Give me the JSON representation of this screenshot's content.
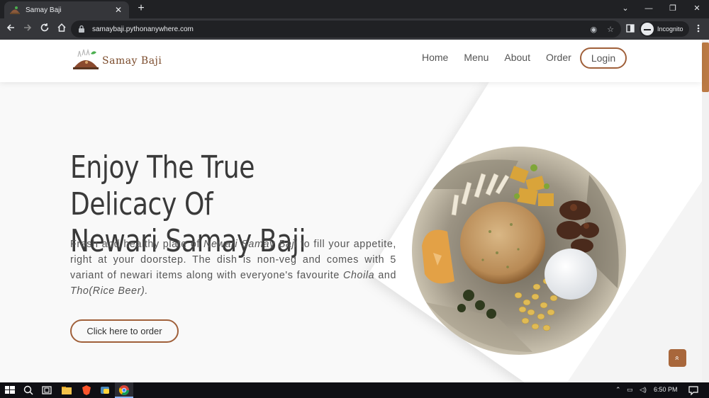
{
  "browser": {
    "tab_title": "Samay Baji",
    "tab_close": "✕",
    "new_tab": "+",
    "url": "samaybaji.pythonanywhere.com",
    "incognito_label": "Incognito",
    "window_controls": {
      "minimize": "⌄",
      "min": "—",
      "restore": "❐",
      "close": "✕"
    }
  },
  "site": {
    "brand_name": "Samay Baji",
    "nav": {
      "home": "Home",
      "menu": "Menu",
      "about": "About",
      "order": "Order",
      "login": "Login"
    },
    "hero": {
      "title_line1": "Enjoy The True Delicacy Of",
      "title_line2": "Newari Samay Baji",
      "desc_part1": "Fresh and healthy plate of ",
      "desc_em1": "Newari Samay Baji",
      "desc_part2": "  to fill your appetite, right at your doorstep. The dish is non-veg and comes with 5 variant of newari items along with everyone's favourite ",
      "desc_em2": "Choila",
      "desc_part3": " and ",
      "desc_em3": "Tho(Rice Beer).",
      "order_button": "Click here to order"
    },
    "back_to_top": "»",
    "accent_color": "#a0603a"
  },
  "taskbar": {
    "time": "6:50 PM"
  }
}
